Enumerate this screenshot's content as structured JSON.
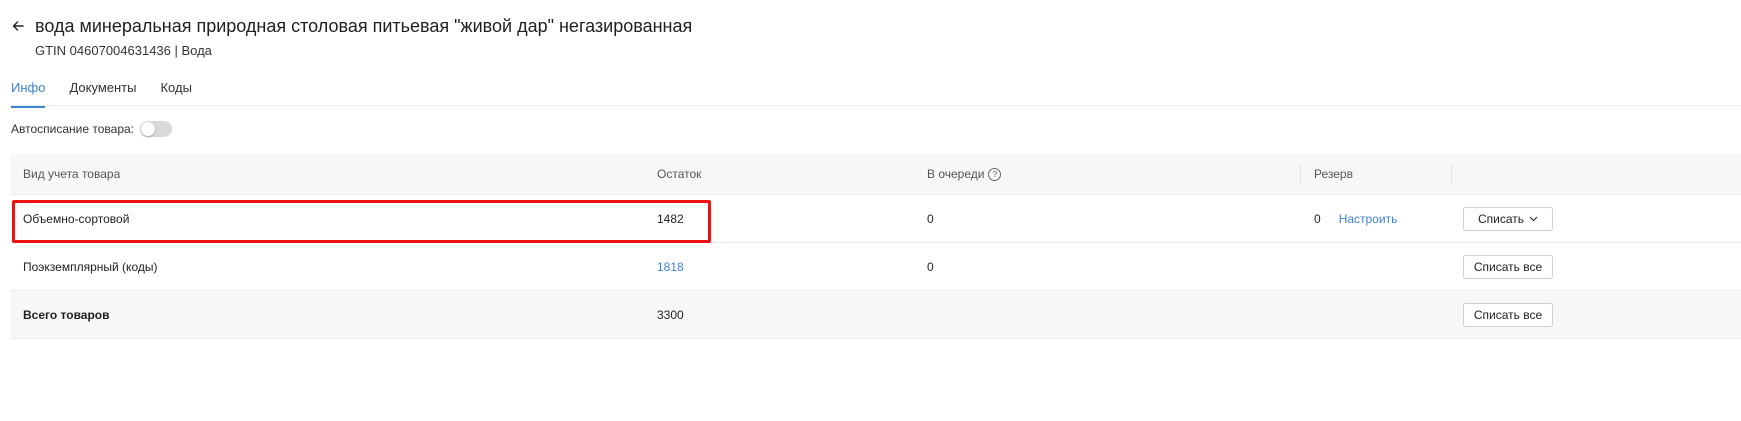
{
  "product": {
    "title": "вода минеральная природная столовая питьевая \"живой дар\" негазированная",
    "subtitle": "GTIN 04607004631436 | Вода"
  },
  "tabs": [
    {
      "label": "Инфо",
      "active": true
    },
    {
      "label": "Документы",
      "active": false
    },
    {
      "label": "Коды",
      "active": false
    }
  ],
  "autowriteoff": {
    "label": "Автосписание товара:",
    "enabled": false
  },
  "table": {
    "headers": {
      "type": "Вид учета товара",
      "balance": "Остаток",
      "queue": "В очереди",
      "reserve": "Резерв"
    },
    "rows": [
      {
        "type": "Объемно-сортовой",
        "balance": "1482",
        "queue": "0",
        "reserve": "0",
        "reserve_link": "Настроить",
        "action": "Списать"
      },
      {
        "type": "Поэкземплярный (коды)",
        "balance": "1818",
        "queue": "0",
        "action": "Списать все"
      }
    ],
    "total": {
      "label": "Всего товаров",
      "balance": "3300",
      "action": "Списать все"
    }
  },
  "icons": {
    "back": "arrow-left-icon",
    "help": "question-circle-icon",
    "dropdown": "chevron-down-icon"
  },
  "colors": {
    "accent": "#3b82d6",
    "highlight": "#ee1111",
    "header_bg": "#f7f7f7"
  }
}
